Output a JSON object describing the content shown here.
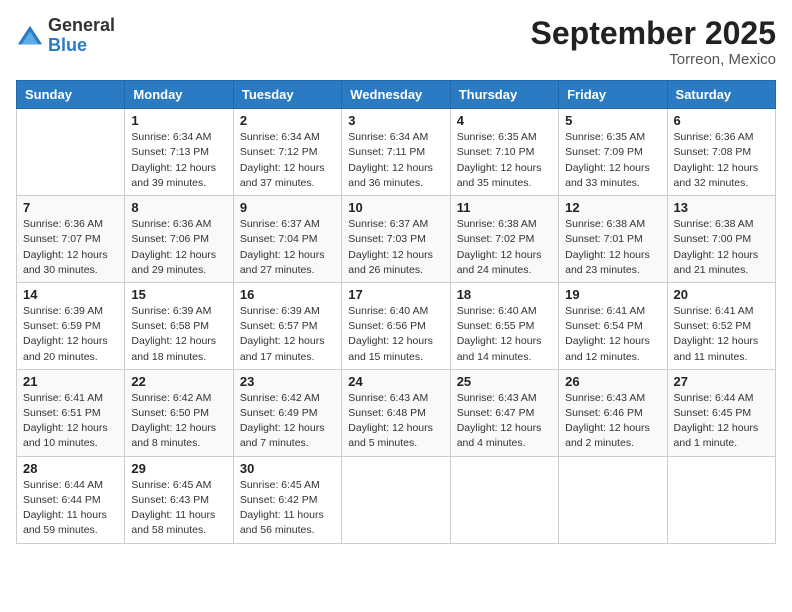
{
  "logo": {
    "general": "General",
    "blue": "Blue"
  },
  "header": {
    "month": "September 2025",
    "location": "Torreon, Mexico"
  },
  "weekdays": [
    "Sunday",
    "Monday",
    "Tuesday",
    "Wednesday",
    "Thursday",
    "Friday",
    "Saturday"
  ],
  "weeks": [
    [
      {
        "day": "",
        "info": ""
      },
      {
        "day": "1",
        "info": "Sunrise: 6:34 AM\nSunset: 7:13 PM\nDaylight: 12 hours\nand 39 minutes."
      },
      {
        "day": "2",
        "info": "Sunrise: 6:34 AM\nSunset: 7:12 PM\nDaylight: 12 hours\nand 37 minutes."
      },
      {
        "day": "3",
        "info": "Sunrise: 6:34 AM\nSunset: 7:11 PM\nDaylight: 12 hours\nand 36 minutes."
      },
      {
        "day": "4",
        "info": "Sunrise: 6:35 AM\nSunset: 7:10 PM\nDaylight: 12 hours\nand 35 minutes."
      },
      {
        "day": "5",
        "info": "Sunrise: 6:35 AM\nSunset: 7:09 PM\nDaylight: 12 hours\nand 33 minutes."
      },
      {
        "day": "6",
        "info": "Sunrise: 6:36 AM\nSunset: 7:08 PM\nDaylight: 12 hours\nand 32 minutes."
      }
    ],
    [
      {
        "day": "7",
        "info": "Sunrise: 6:36 AM\nSunset: 7:07 PM\nDaylight: 12 hours\nand 30 minutes."
      },
      {
        "day": "8",
        "info": "Sunrise: 6:36 AM\nSunset: 7:06 PM\nDaylight: 12 hours\nand 29 minutes."
      },
      {
        "day": "9",
        "info": "Sunrise: 6:37 AM\nSunset: 7:04 PM\nDaylight: 12 hours\nand 27 minutes."
      },
      {
        "day": "10",
        "info": "Sunrise: 6:37 AM\nSunset: 7:03 PM\nDaylight: 12 hours\nand 26 minutes."
      },
      {
        "day": "11",
        "info": "Sunrise: 6:38 AM\nSunset: 7:02 PM\nDaylight: 12 hours\nand 24 minutes."
      },
      {
        "day": "12",
        "info": "Sunrise: 6:38 AM\nSunset: 7:01 PM\nDaylight: 12 hours\nand 23 minutes."
      },
      {
        "day": "13",
        "info": "Sunrise: 6:38 AM\nSunset: 7:00 PM\nDaylight: 12 hours\nand 21 minutes."
      }
    ],
    [
      {
        "day": "14",
        "info": "Sunrise: 6:39 AM\nSunset: 6:59 PM\nDaylight: 12 hours\nand 20 minutes."
      },
      {
        "day": "15",
        "info": "Sunrise: 6:39 AM\nSunset: 6:58 PM\nDaylight: 12 hours\nand 18 minutes."
      },
      {
        "day": "16",
        "info": "Sunrise: 6:39 AM\nSunset: 6:57 PM\nDaylight: 12 hours\nand 17 minutes."
      },
      {
        "day": "17",
        "info": "Sunrise: 6:40 AM\nSunset: 6:56 PM\nDaylight: 12 hours\nand 15 minutes."
      },
      {
        "day": "18",
        "info": "Sunrise: 6:40 AM\nSunset: 6:55 PM\nDaylight: 12 hours\nand 14 minutes."
      },
      {
        "day": "19",
        "info": "Sunrise: 6:41 AM\nSunset: 6:54 PM\nDaylight: 12 hours\nand 12 minutes."
      },
      {
        "day": "20",
        "info": "Sunrise: 6:41 AM\nSunset: 6:52 PM\nDaylight: 12 hours\nand 11 minutes."
      }
    ],
    [
      {
        "day": "21",
        "info": "Sunrise: 6:41 AM\nSunset: 6:51 PM\nDaylight: 12 hours\nand 10 minutes."
      },
      {
        "day": "22",
        "info": "Sunrise: 6:42 AM\nSunset: 6:50 PM\nDaylight: 12 hours\nand 8 minutes."
      },
      {
        "day": "23",
        "info": "Sunrise: 6:42 AM\nSunset: 6:49 PM\nDaylight: 12 hours\nand 7 minutes."
      },
      {
        "day": "24",
        "info": "Sunrise: 6:43 AM\nSunset: 6:48 PM\nDaylight: 12 hours\nand 5 minutes."
      },
      {
        "day": "25",
        "info": "Sunrise: 6:43 AM\nSunset: 6:47 PM\nDaylight: 12 hours\nand 4 minutes."
      },
      {
        "day": "26",
        "info": "Sunrise: 6:43 AM\nSunset: 6:46 PM\nDaylight: 12 hours\nand 2 minutes."
      },
      {
        "day": "27",
        "info": "Sunrise: 6:44 AM\nSunset: 6:45 PM\nDaylight: 12 hours\nand 1 minute."
      }
    ],
    [
      {
        "day": "28",
        "info": "Sunrise: 6:44 AM\nSunset: 6:44 PM\nDaylight: 11 hours\nand 59 minutes."
      },
      {
        "day": "29",
        "info": "Sunrise: 6:45 AM\nSunset: 6:43 PM\nDaylight: 11 hours\nand 58 minutes."
      },
      {
        "day": "30",
        "info": "Sunrise: 6:45 AM\nSunset: 6:42 PM\nDaylight: 11 hours\nand 56 minutes."
      },
      {
        "day": "",
        "info": ""
      },
      {
        "day": "",
        "info": ""
      },
      {
        "day": "",
        "info": ""
      },
      {
        "day": "",
        "info": ""
      }
    ]
  ]
}
